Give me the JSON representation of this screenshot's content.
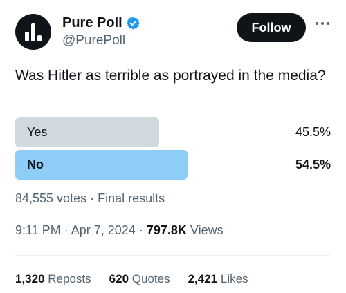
{
  "account": {
    "name": "Pure Poll",
    "handle": "@PurePoll",
    "verified_color": "#1d9bf0",
    "avatar_icon": "bar-chart-logo-icon"
  },
  "follow_label": "Follow",
  "more_icon": "more-horizontal-icon",
  "question": "Was Hitler as terrible as portrayed in the media?",
  "poll": {
    "options": [
      {
        "label": "Yes",
        "percent": "45.5%",
        "share": 45.5,
        "color": "#cfd9de",
        "leading": false
      },
      {
        "label": "No",
        "percent": "54.5%",
        "share": 54.5,
        "color": "#8ecdf8",
        "leading": true
      }
    ],
    "votes": "84,555 votes",
    "separator": "·",
    "status": "Final results"
  },
  "meta": {
    "time": "9:11 PM",
    "date": "Apr 7, 2024",
    "separator": "·",
    "views_count": "797.8K",
    "views_label": "Views"
  },
  "stats": {
    "reposts_count": "1,320",
    "reposts_label": "Reposts",
    "quotes_count": "620",
    "quotes_label": "Quotes",
    "likes_count": "2,421",
    "likes_label": "Likes"
  }
}
